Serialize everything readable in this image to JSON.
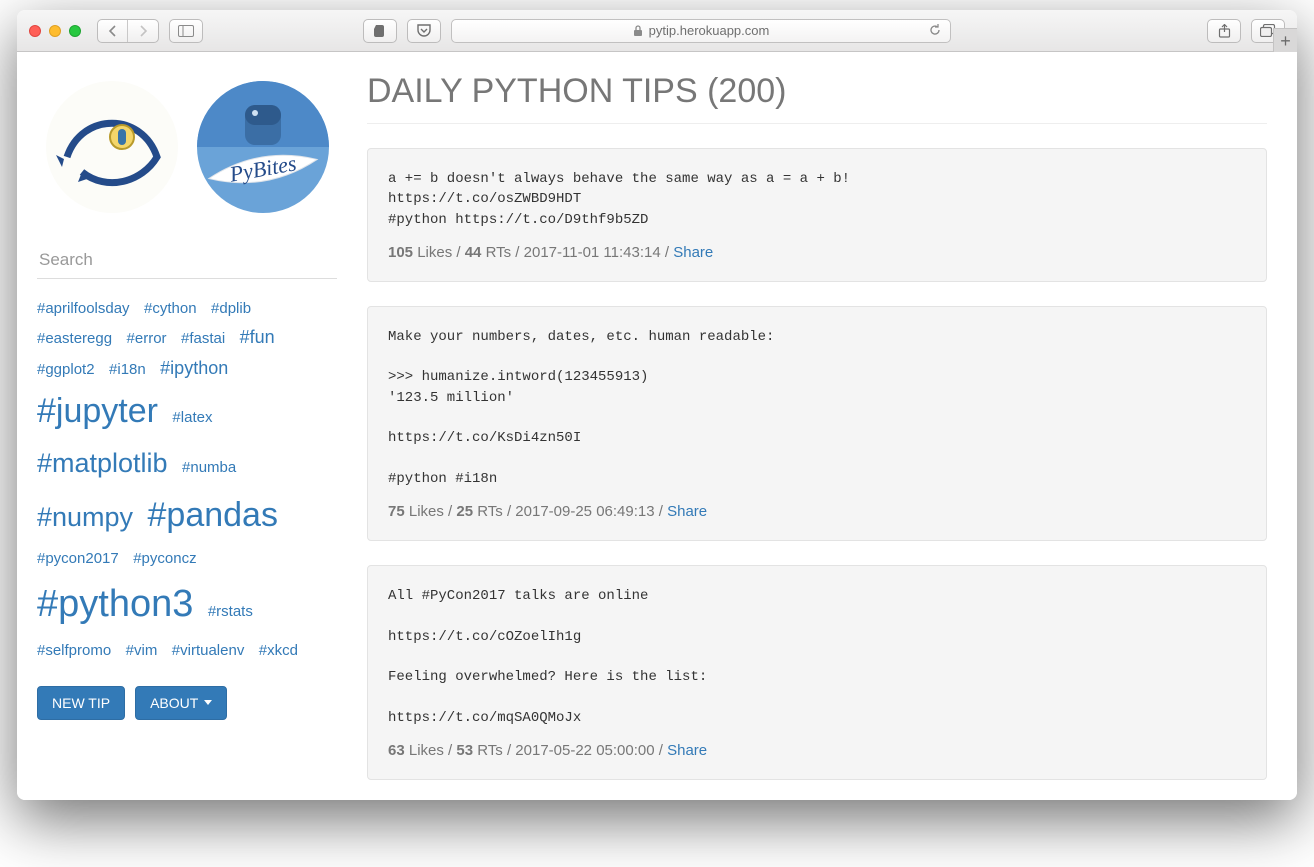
{
  "chrome": {
    "url": "pytip.herokuapp.com"
  },
  "page": {
    "title": "DAILY PYTHON TIPS (200)"
  },
  "search": {
    "placeholder": "Search"
  },
  "tags": [
    {
      "label": "#aprilfoolsday",
      "size": 1
    },
    {
      "label": "#cython",
      "size": 1
    },
    {
      "label": "#dplib",
      "size": 1
    },
    {
      "label": "#easteregg",
      "size": 1
    },
    {
      "label": "#error",
      "size": 1
    },
    {
      "label": "#fastai",
      "size": 1
    },
    {
      "label": "#fun",
      "size": 2
    },
    {
      "label": "#ggplot2",
      "size": 1
    },
    {
      "label": "#i18n",
      "size": 1
    },
    {
      "label": "#ipython",
      "size": 2
    },
    {
      "label": "#jupyter",
      "size": 5
    },
    {
      "label": "#latex",
      "size": 1
    },
    {
      "label": "#matplotlib",
      "size": 4
    },
    {
      "label": "#numba",
      "size": 1
    },
    {
      "label": "#numpy",
      "size": 4
    },
    {
      "label": "#pandas",
      "size": 5
    },
    {
      "label": "#pycon2017",
      "size": 1
    },
    {
      "label": "#pyconcz",
      "size": 1
    },
    {
      "label": "#python3",
      "size": 6
    },
    {
      "label": "#rstats",
      "size": 1
    },
    {
      "label": "#selfpromo",
      "size": 1
    },
    {
      "label": "#vim",
      "size": 1
    },
    {
      "label": "#virtualenv",
      "size": 1
    },
    {
      "label": "#xkcd",
      "size": 1
    }
  ],
  "buttons": {
    "new_tip": "NEW TIP",
    "about": "ABOUT"
  },
  "tips": [
    {
      "body": "a += b doesn't always behave the same way as a = a + b!\nhttps://t.co/osZWBD9HDT\n#python https://t.co/D9thf9b5ZD",
      "likes": "105",
      "rts": "44",
      "ts": "2017-11-01 11:43:14",
      "share": "Share"
    },
    {
      "body": "Make your numbers, dates, etc. human readable:\n\n>>> humanize.intword(123455913)\n'123.5 million'\n\nhttps://t.co/KsDi4zn50I\n\n#python #i18n",
      "likes": "75",
      "rts": "25",
      "ts": "2017-09-25 06:49:13",
      "share": "Share"
    },
    {
      "body": "All #PyCon2017 talks are online\n\nhttps://t.co/cOZoelIh1g\n\nFeeling overwhelmed? Here is the list:\n\nhttps://t.co/mqSA0QMoJx",
      "likes": "63",
      "rts": "53",
      "ts": "2017-05-22 05:00:00",
      "share": "Share"
    }
  ],
  "meta_text": {
    "likes": " Likes / ",
    "rts": " RTs / ",
    "sep": " / "
  }
}
